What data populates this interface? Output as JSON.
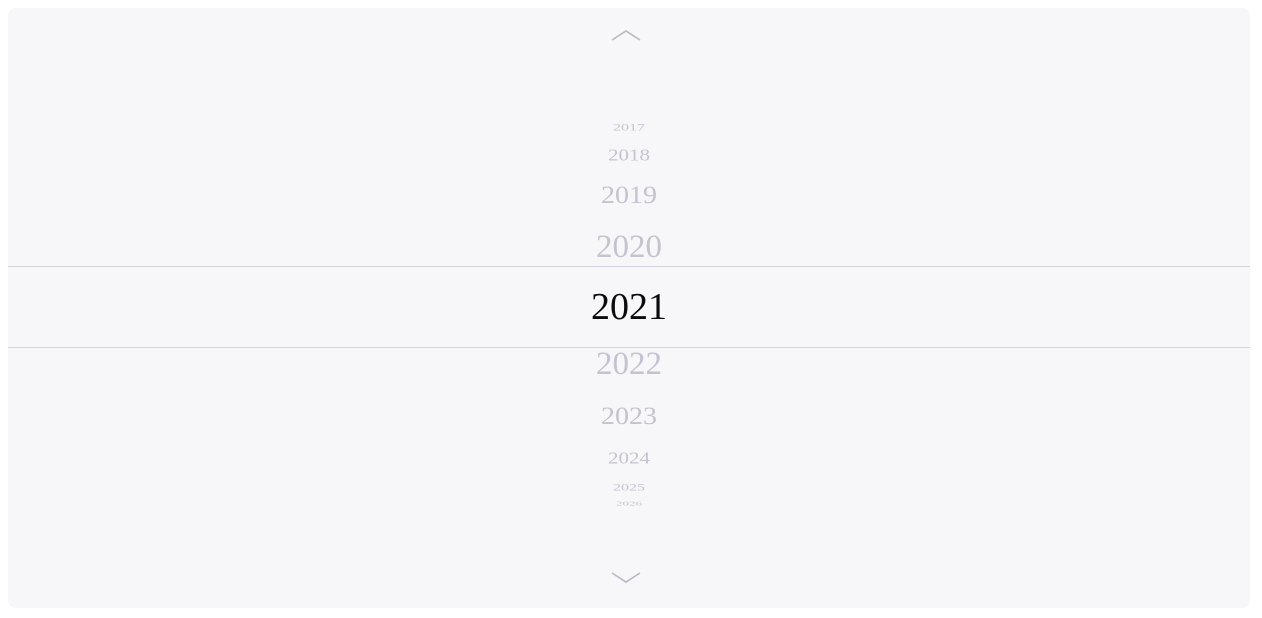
{
  "picker": {
    "scroll_up_icon": "chevron-up-icon",
    "scroll_down_icon": "chevron-down-icon",
    "selected_year": "2021",
    "years": [
      "2017",
      "2018",
      "2019",
      "2020",
      "2021",
      "2022",
      "2023",
      "2024",
      "2025",
      "2026"
    ]
  },
  "colors": {
    "background": "#f7f7f9",
    "selected_text": "#0b0b0b",
    "unselected_text": "#c4c3cf",
    "divider": "#d4d4da",
    "chevron": "#b9b8c4"
  }
}
